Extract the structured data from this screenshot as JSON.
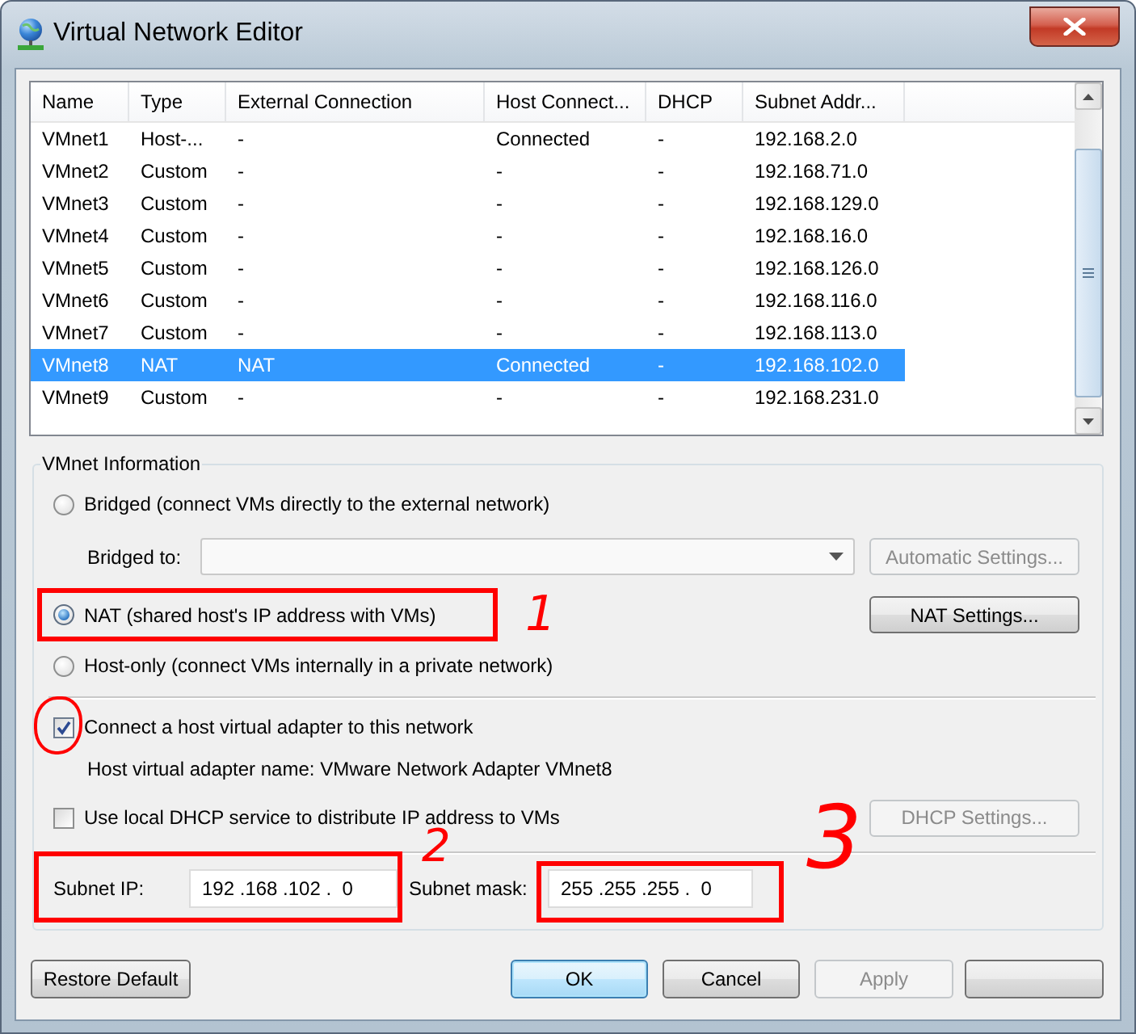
{
  "window": {
    "title": "Virtual Network Editor"
  },
  "network_table": {
    "columns": [
      "Name",
      "Type",
      "External Connection",
      "Host Connect...",
      "DHCP",
      "Subnet Addr..."
    ],
    "rows": [
      {
        "cells": [
          "VMnet1",
          "Host-...",
          "-",
          "Connected",
          "-",
          "192.168.2.0"
        ],
        "selected": false
      },
      {
        "cells": [
          "VMnet2",
          "Custom",
          "-",
          "-",
          "-",
          "192.168.71.0"
        ],
        "selected": false
      },
      {
        "cells": [
          "VMnet3",
          "Custom",
          "-",
          "-",
          "-",
          "192.168.129.0"
        ],
        "selected": false
      },
      {
        "cells": [
          "VMnet4",
          "Custom",
          "-",
          "-",
          "-",
          "192.168.16.0"
        ],
        "selected": false
      },
      {
        "cells": [
          "VMnet5",
          "Custom",
          "-",
          "-",
          "-",
          "192.168.126.0"
        ],
        "selected": false
      },
      {
        "cells": [
          "VMnet6",
          "Custom",
          "-",
          "-",
          "-",
          "192.168.116.0"
        ],
        "selected": false
      },
      {
        "cells": [
          "VMnet7",
          "Custom",
          "-",
          "-",
          "-",
          "192.168.113.0"
        ],
        "selected": false
      },
      {
        "cells": [
          "VMnet8",
          "NAT",
          "NAT",
          "Connected",
          "-",
          "192.168.102.0"
        ],
        "selected": true
      },
      {
        "cells": [
          "VMnet9",
          "Custom",
          "-",
          "-",
          "-",
          "192.168.231.0"
        ],
        "selected": false
      }
    ]
  },
  "vmnet_information": {
    "title": "VMnet Information",
    "modes": [
      {
        "label": "Bridged (connect VMs directly to the external network)",
        "selected": false
      },
      {
        "label": "NAT (shared host's IP address with VMs)",
        "selected": true,
        "button": {
          "label": "NAT Settings...",
          "disabled": false
        },
        "annotation": {
          "kind": "box",
          "number": "1"
        }
      },
      {
        "label": "Host-only (connect VMs internally in a private network)",
        "selected": false
      }
    ],
    "bridged_to": {
      "label": "Bridged to:",
      "button": {
        "label": "Automatic Settings...",
        "disabled": true
      }
    },
    "connect_adapter": {
      "label": "Connect a host virtual adapter to this network",
      "checked": true,
      "annotation": {
        "kind": "circle"
      }
    },
    "adapter_name": "Host virtual adapter name: VMware Network Adapter VMnet8",
    "use_dhcp": {
      "label": "Use local DHCP service to distribute IP address to VMs",
      "checked": false,
      "button": {
        "label": "DHCP Settings...",
        "disabled": true
      }
    },
    "subnet_ip": {
      "label": "Subnet IP:",
      "value": "192 .168 .102 .  0",
      "annotation": {
        "kind": "box",
        "number": "2"
      }
    },
    "subnet_mask": {
      "label": "Subnet mask:",
      "value": "255 .255 .255 .  0",
      "annotation": {
        "kind": "box",
        "number": "3"
      }
    }
  },
  "buttons": [
    {
      "label": "Restore Default",
      "default": false,
      "disabled": false
    },
    {
      "label": "OK",
      "default": true,
      "disabled": false
    },
    {
      "label": "Cancel",
      "default": false,
      "disabled": false
    },
    {
      "label": "Apply",
      "default": false,
      "disabled": true
    }
  ]
}
